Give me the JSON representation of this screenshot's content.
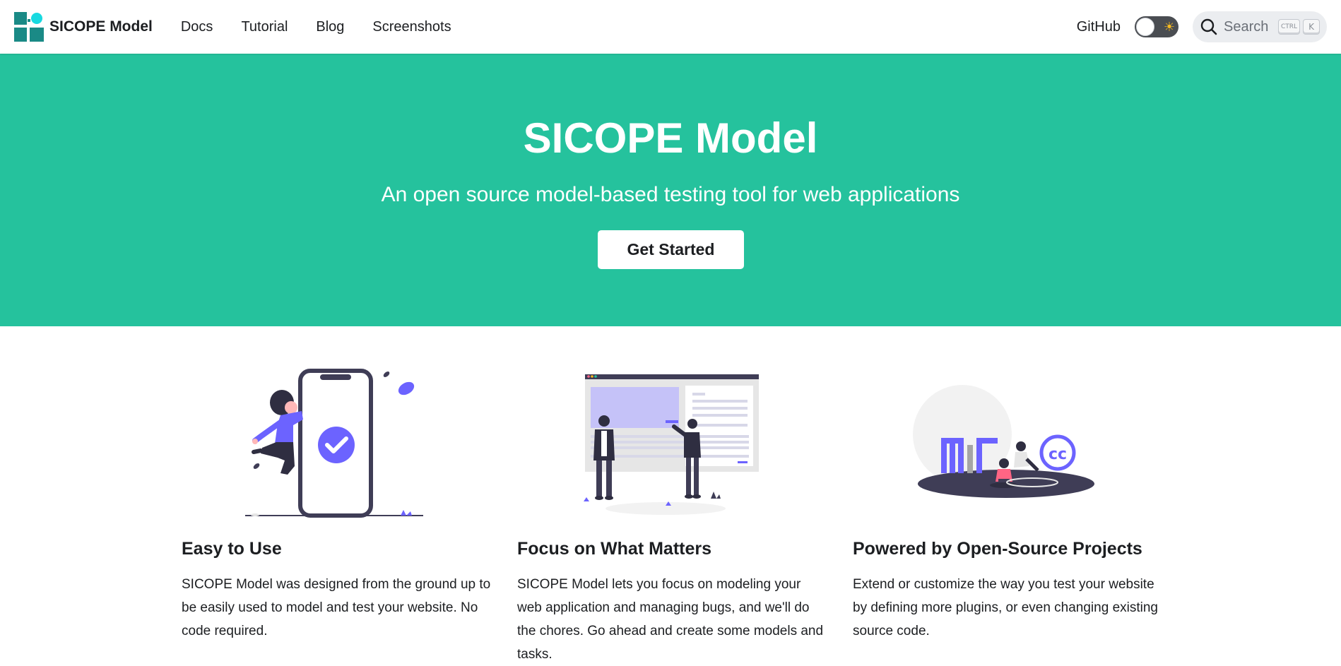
{
  "navbar": {
    "brand_title": "SICOPE Model",
    "links": [
      "Docs",
      "Tutorial",
      "Blog",
      "Screenshots"
    ],
    "github_label": "GitHub",
    "theme_toggle_icon": "sun-icon",
    "search": {
      "placeholder": "Search",
      "shortcut_keys": [
        "CTRL",
        "K"
      ]
    }
  },
  "hero": {
    "title": "SICOPE Model",
    "subtitle": "An open source model-based testing tool for web applications",
    "cta_label": "Get Started",
    "background_color": "#25c29d"
  },
  "features": [
    {
      "title": "Easy to Use",
      "description": "SICOPE Model was designed from the ground up to be easily used to model and test your website. No code required.",
      "illustration": "woman-jumping-phone-check-illustration"
    },
    {
      "title": "Focus on What Matters",
      "description": "SICOPE Model lets you focus on modeling your web application and managing bugs, and we'll do the chores. Go ahead and create some models and tasks.",
      "illustration": "people-presenting-webpage-illustration"
    },
    {
      "title": "Powered by Open-Source Projects",
      "description": "Extend or customize the way you test your website by defining more plugins, or even changing existing source code.",
      "illustration": "mit-cc-open-source-illustration"
    }
  ],
  "colors": {
    "accent": "#25c29d",
    "illustration_purple": "#6c63ff",
    "illustration_dark": "#3f3d56"
  }
}
